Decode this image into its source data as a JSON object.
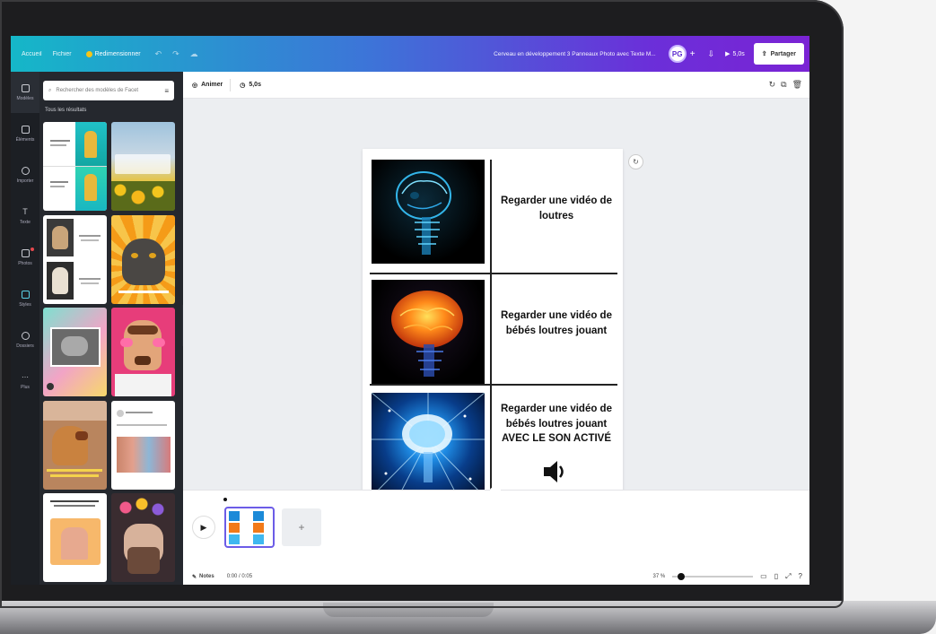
{
  "topbar": {
    "home": "Accueil",
    "file": "Fichier",
    "resize": "Redimensionner",
    "doc_title": "Cerveau en développement 3 Panneaux Photo avec Texte M...",
    "avatar": "PG",
    "play": "5,0s",
    "share": "Partager"
  },
  "rail": {
    "items": [
      {
        "label": "Modèles",
        "icon": "layout-icon"
      },
      {
        "label": "Éléments",
        "icon": "shapes-icon"
      },
      {
        "label": "Importer",
        "icon": "upload-icon"
      },
      {
        "label": "Texte",
        "icon": "text-icon"
      },
      {
        "label": "Photos",
        "icon": "photo-icon"
      },
      {
        "label": "Styles",
        "icon": "brush-icon"
      },
      {
        "label": "Dossiers",
        "icon": "folder-icon"
      },
      {
        "label": "Plus",
        "icon": "more-icon"
      }
    ]
  },
  "panel": {
    "search_placeholder": "Rechercher des modèles de Facet",
    "results_label": "Tous les résultats"
  },
  "toolbar": {
    "animate": "Animer",
    "duration": "5,0s"
  },
  "meme": {
    "panels": [
      {
        "text": "Regarder une vidéo de loutres",
        "color": "#33b9ff"
      },
      {
        "text": "Regarder une vidéo de bébés loutres jouant",
        "color": "#ff8a1a"
      },
      {
        "text": "Regarder une vidéo de bébés loutres jouant AVEC LE SON ACTIVÉ",
        "color": "#5fd4ff"
      }
    ]
  },
  "timeline": {
    "notes": "Notes",
    "timecode": "0:00 / 0:05",
    "zoom": "37 %"
  },
  "colors": {
    "accent": "#6b2fd9",
    "teal": "#15b7c8",
    "dark_panel": "#25282e"
  }
}
